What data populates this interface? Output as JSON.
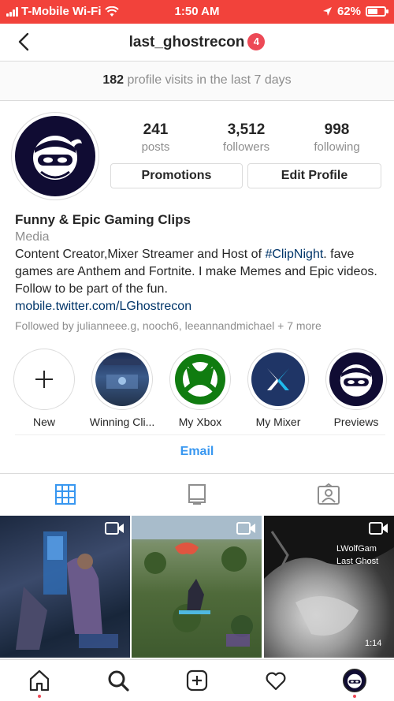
{
  "status_bar": {
    "carrier": "T-Mobile Wi-Fi",
    "time": "1:50 AM",
    "battery": "62%",
    "battery_level": 0.62
  },
  "header": {
    "username": "last_ghostrecon",
    "notification_count": "4"
  },
  "visits_banner": {
    "count": "182",
    "text": "profile visits in the last 7 days"
  },
  "stats": [
    {
      "value": "241",
      "label": "posts"
    },
    {
      "value": "3,512",
      "label": "followers"
    },
    {
      "value": "998",
      "label": "following"
    }
  ],
  "buttons": {
    "promotions": "Promotions",
    "edit_profile": "Edit Profile"
  },
  "bio": {
    "name": "Funny & Epic Gaming Clips",
    "category": "Media",
    "text_before_tag": "Content Creator,Mixer Streamer and Host of ",
    "hashtag": "#ClipNight",
    "text_after_tag": ". fave games are Anthem and Fortnite. I make Memes and Epic videos. Follow to be part of the fun.",
    "link": "mobile.twitter.com/LGhostrecon",
    "followed_by": "Followed by julianneee.g, nooch6, leeannandmichael + 7 more"
  },
  "highlights": [
    {
      "label": "New"
    },
    {
      "label": "Winning Cli..."
    },
    {
      "label": "My Xbox"
    },
    {
      "label": "My Mixer"
    },
    {
      "label": "Previews"
    }
  ],
  "email_button": "Email",
  "grid_posts": [
    {
      "overlay_lines": []
    },
    {
      "overlay_lines": []
    },
    {
      "overlay_lines": [
        "LWolfGam",
        "Last Ghost",
        "1:14"
      ]
    }
  ],
  "colors": {
    "status_bar": "#f2423b",
    "link_blue": "#3897f0",
    "hashtag_blue": "#003569",
    "badge_red": "#ed4956",
    "avatar_navy": "#100c33",
    "xbox_green": "#107c10",
    "mixer_navy": "#1f3566"
  }
}
